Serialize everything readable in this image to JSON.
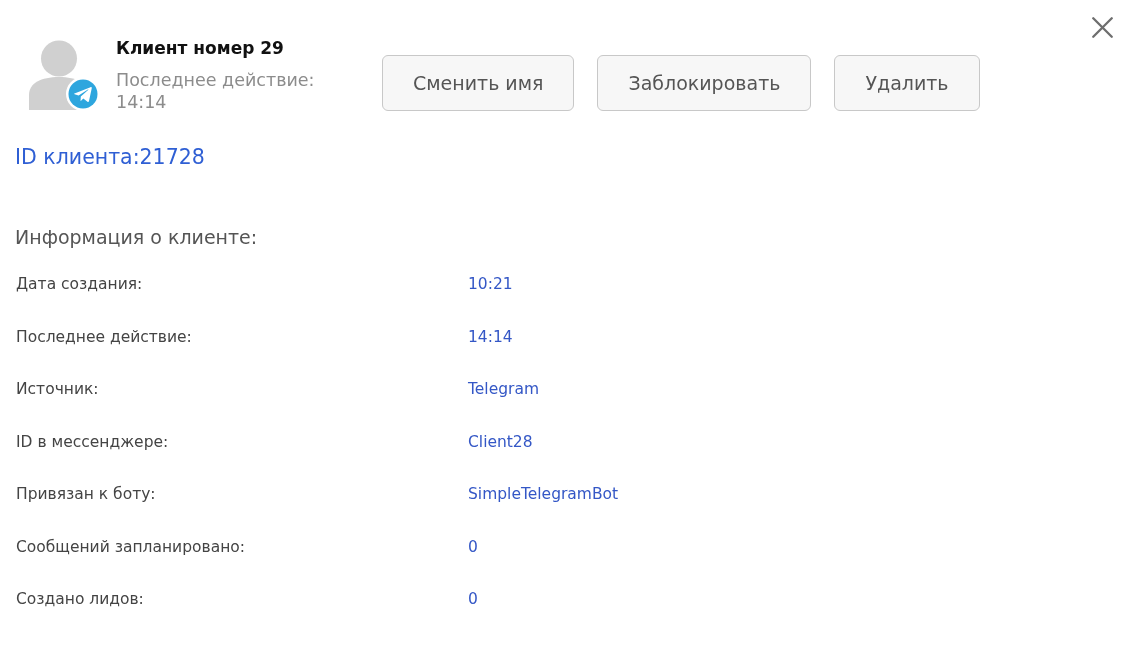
{
  "client": {
    "name": "Клиент номер 29",
    "last_action": "Последнее действие: 14:14"
  },
  "actions": [
    {
      "label": "Сменить имя"
    },
    {
      "label": "Заблокировать"
    },
    {
      "label": "Удалить"
    }
  ],
  "client_id": "ID клиента:21728",
  "info": {
    "title": "Информация о клиенте:",
    "rows": [
      {
        "label": "Дата создания:",
        "value": "10:21"
      },
      {
        "label": "Последнее действие:",
        "value": "14:14"
      },
      {
        "label": "Источник:",
        "value": "Telegram"
      },
      {
        "label": "ID в мессенджере:",
        "value": "Client28"
      },
      {
        "label": "Привязан к боту:",
        "value": "SimpleTelegramBot"
      },
      {
        "label": "Сообщений запланировано:",
        "value": "0"
      },
      {
        "label": "Создано лидов:",
        "value": "0"
      }
    ]
  }
}
